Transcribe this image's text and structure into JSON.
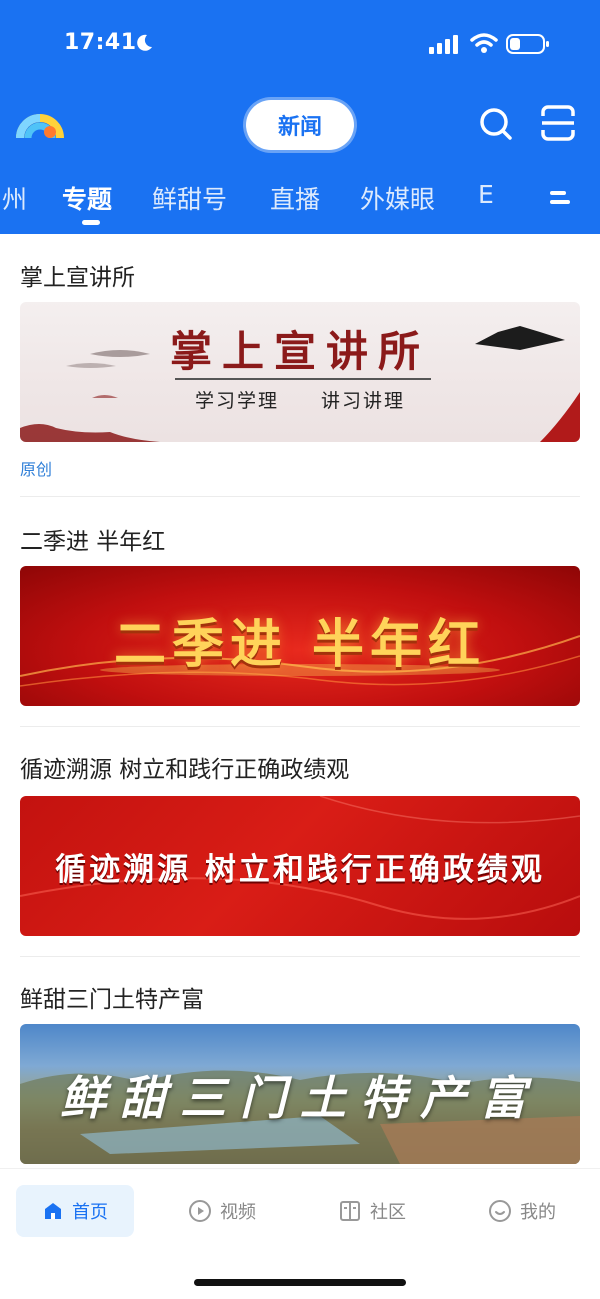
{
  "status_bar": {
    "time": "17:41"
  },
  "header": {
    "center_pill": "新闻"
  },
  "tabs": [
    "州",
    "专题",
    "鲜甜号",
    "直播",
    "外媒眼",
    "E"
  ],
  "active_tab": "专题",
  "feed": [
    {
      "title": "掌上宣讲所",
      "banner_title": "掌上宣讲所",
      "banner_subtitle": "学习学理　　讲习讲理",
      "tag": "原创"
    },
    {
      "title": "二季进 半年红",
      "banner_title": "二季进 半年红"
    },
    {
      "title": "循迹溯源 树立和践行正确政绩观",
      "banner_title": "循迹溯源 树立和践行正确政绩观"
    },
    {
      "title": "鲜甜三门土特产富",
      "banner_title": "鲜甜三门土特产富"
    }
  ],
  "bottom_nav": [
    {
      "label": "首页",
      "icon": "home-icon",
      "active": true
    },
    {
      "label": "视频",
      "icon": "play-icon",
      "active": false
    },
    {
      "label": "社区",
      "icon": "community-icon",
      "active": false
    },
    {
      "label": "我的",
      "icon": "smile-icon",
      "active": false
    }
  ],
  "colors": {
    "brand": "#1a72f2",
    "tag": "#2f7fd8",
    "banner_red": "#c10f0f",
    "banner_gold": "#ffd35a"
  }
}
